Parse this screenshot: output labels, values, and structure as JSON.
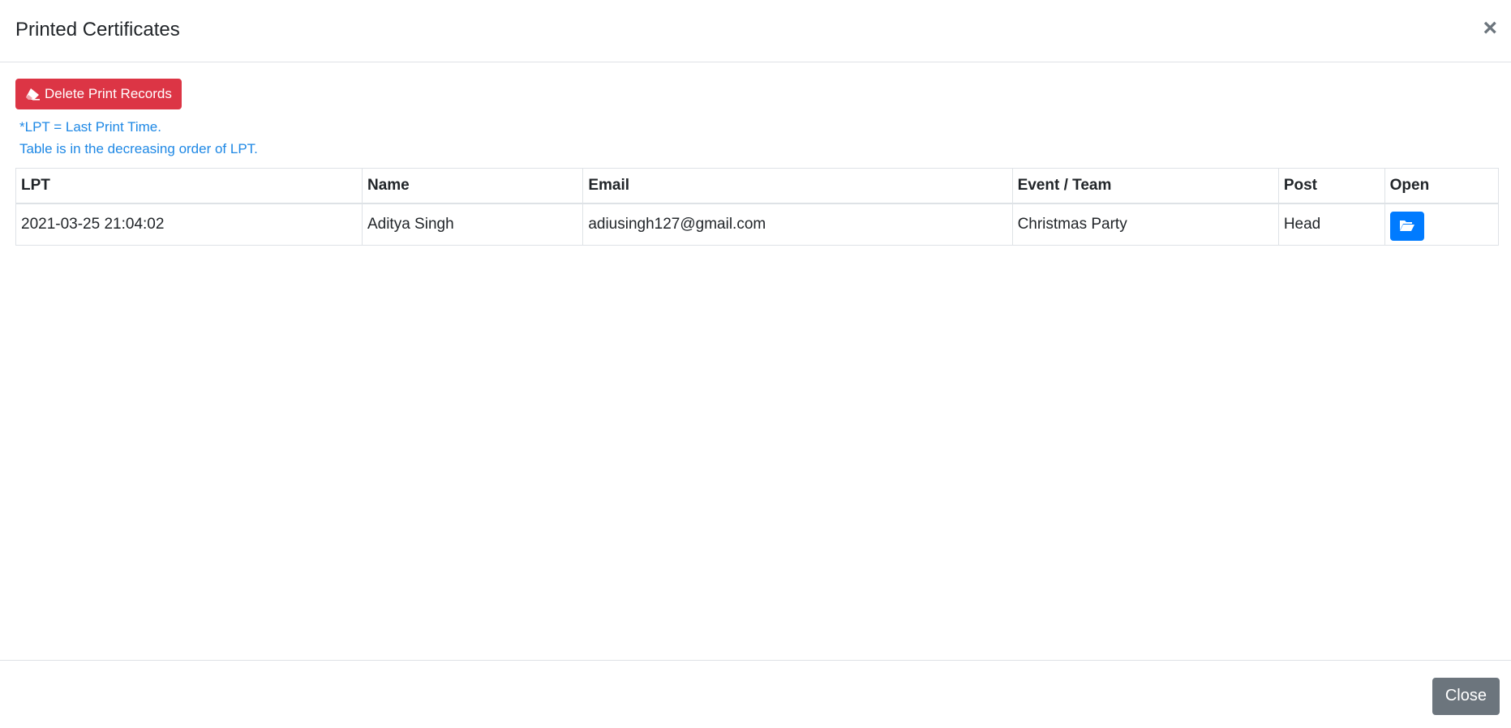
{
  "modal": {
    "title": "Printed Certificates",
    "close_symbol": "×"
  },
  "toolbar": {
    "delete_label": "Delete Print Records",
    "delete_icon": "eraser-icon",
    "delete_color": "#dc3545"
  },
  "notes": {
    "line1": "*LPT = Last Print Time.",
    "line2": "Table is in the decreasing order of LPT.",
    "color": "#1e88e5"
  },
  "table": {
    "headers": [
      "LPT",
      "Name",
      "Email",
      "Event / Team",
      "Post",
      "Open"
    ],
    "rows": [
      {
        "lpt": "2021-03-25 21:04:02",
        "name": "Aditya Singh",
        "email": "adiusingh127@gmail.com",
        "event_team": "Christmas Party",
        "post": "Head",
        "open_icon": "folder-open-icon"
      }
    ]
  },
  "footer": {
    "close_label": "Close"
  },
  "colors": {
    "primary": "#007bff",
    "secondary": "#6c757d"
  }
}
